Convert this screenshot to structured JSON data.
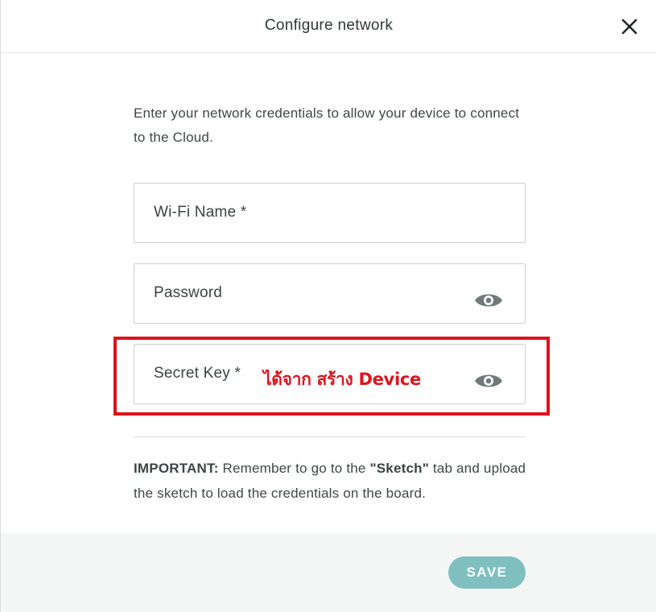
{
  "dialog": {
    "title": "Configure network",
    "close_icon": "close-icon",
    "intro": "Enter your network credentials to allow your device to connect to the Cloud."
  },
  "form": {
    "wifi_name": {
      "label": "Wi-Fi Name *",
      "value": ""
    },
    "password": {
      "label": "Password",
      "value": "",
      "icon": "eye-icon"
    },
    "secret_key": {
      "label": "Secret Key *",
      "value": "",
      "icon": "eye-icon"
    }
  },
  "annotation": {
    "text": "ได้จาก สร้าง Device",
    "color": "#e0121c"
  },
  "important": {
    "prefix": "IMPORTANT:",
    "text_1": " Remember to go to the ",
    "tab_name": "\"Sketch\"",
    "text_2": " tab and upload the sketch to load the credentials on the board."
  },
  "footer": {
    "save_label": "SAVE",
    "save_color": "#7fbfbf"
  }
}
